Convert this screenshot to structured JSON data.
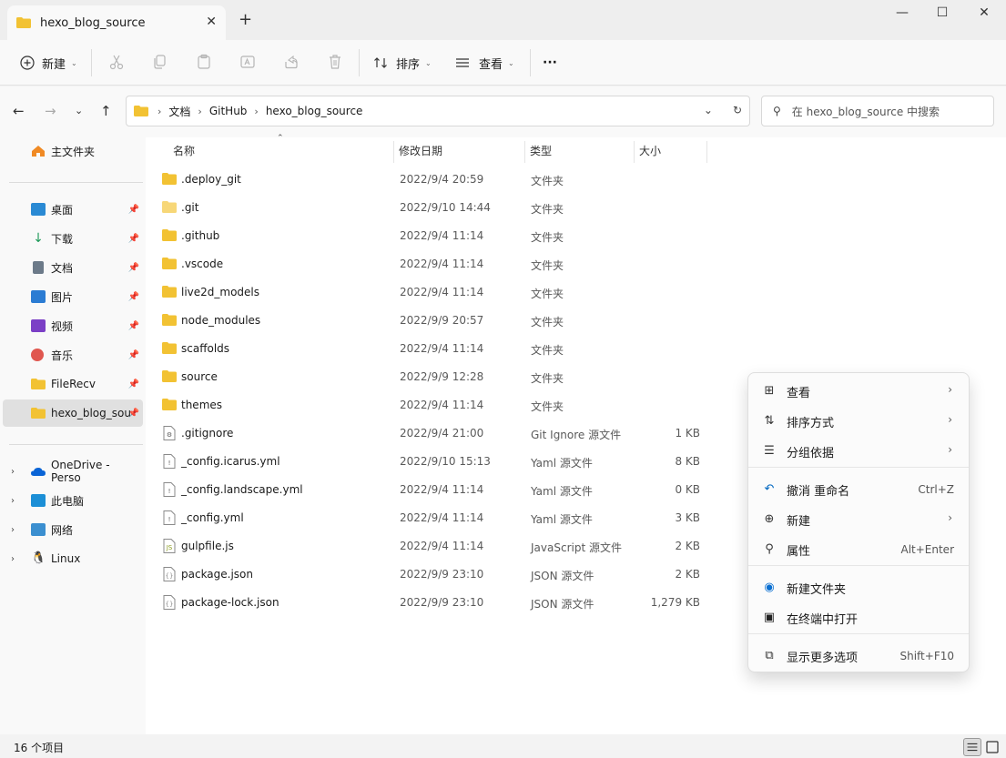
{
  "window": {
    "tab_title": "hexo_blog_source",
    "tab_close": "✕",
    "new_tab": "+",
    "minimize": "—",
    "maximize": "☐",
    "close": "✕"
  },
  "toolbar": {
    "new_label": "新建",
    "sort_label": "排序",
    "view_label": "查看",
    "more_label": "···"
  },
  "address": {
    "crumbs": [
      "文档",
      "GitHub",
      "hexo_blog_source"
    ],
    "search_placeholder": "在 hexo_blog_source 中搜索"
  },
  "sidebar": {
    "home": "主文件夹",
    "pinned": [
      {
        "label": "桌面",
        "icon": "desktop-icon",
        "color": "#2a8ad4"
      },
      {
        "label": "下载",
        "icon": "download-icon",
        "color": "#1f9a5a"
      },
      {
        "label": "文档",
        "icon": "document-icon",
        "color": "#6c7a89"
      },
      {
        "label": "图片",
        "icon": "picture-icon",
        "color": "#2b7cd3"
      },
      {
        "label": "视频",
        "icon": "video-icon",
        "color": "#7b3fc6"
      },
      {
        "label": "音乐",
        "icon": "music-icon",
        "color": "#e0574f"
      },
      {
        "label": "FileRecv",
        "icon": "folder-icon",
        "color": "#f2c233"
      },
      {
        "label": "hexo_blog_sou",
        "icon": "folder-icon",
        "color": "#f2c233"
      }
    ],
    "locations": [
      {
        "label": "OneDrive - Perso",
        "icon": "onedrive-icon"
      },
      {
        "label": "此电脑",
        "icon": "pc-icon"
      },
      {
        "label": "网络",
        "icon": "network-icon"
      },
      {
        "label": "Linux",
        "icon": "linux-icon"
      }
    ]
  },
  "columns": {
    "name": "名称",
    "modified": "修改日期",
    "type": "类型",
    "size": "大小"
  },
  "files": [
    {
      "name": ".deploy_git",
      "modified": "2022/9/4 20:59",
      "type": "文件夹",
      "size": "",
      "icon": "folder"
    },
    {
      "name": ".git",
      "modified": "2022/9/10 14:44",
      "type": "文件夹",
      "size": "",
      "icon": "folder-light"
    },
    {
      "name": ".github",
      "modified": "2022/9/4 11:14",
      "type": "文件夹",
      "size": "",
      "icon": "folder"
    },
    {
      "name": ".vscode",
      "modified": "2022/9/4 11:14",
      "type": "文件夹",
      "size": "",
      "icon": "folder"
    },
    {
      "name": "live2d_models",
      "modified": "2022/9/4 11:14",
      "type": "文件夹",
      "size": "",
      "icon": "folder"
    },
    {
      "name": "node_modules",
      "modified": "2022/9/9 20:57",
      "type": "文件夹",
      "size": "",
      "icon": "folder"
    },
    {
      "name": "scaffolds",
      "modified": "2022/9/4 11:14",
      "type": "文件夹",
      "size": "",
      "icon": "folder"
    },
    {
      "name": "source",
      "modified": "2022/9/9 12:28",
      "type": "文件夹",
      "size": "",
      "icon": "folder"
    },
    {
      "name": "themes",
      "modified": "2022/9/4 11:14",
      "type": "文件夹",
      "size": "",
      "icon": "folder"
    },
    {
      "name": ".gitignore",
      "modified": "2022/9/4 21:00",
      "type": "Git Ignore 源文件",
      "size": "1 KB",
      "icon": "file-gear"
    },
    {
      "name": "_config.icarus.yml",
      "modified": "2022/9/10 15:13",
      "type": "Yaml 源文件",
      "size": "8 KB",
      "icon": "file-bang"
    },
    {
      "name": "_config.landscape.yml",
      "modified": "2022/9/4 11:14",
      "type": "Yaml 源文件",
      "size": "0 KB",
      "icon": "file-bang"
    },
    {
      "name": "_config.yml",
      "modified": "2022/9/4 11:14",
      "type": "Yaml 源文件",
      "size": "3 KB",
      "icon": "file-bang"
    },
    {
      "name": "gulpfile.js",
      "modified": "2022/9/4 11:14",
      "type": "JavaScript 源文件",
      "size": "2 KB",
      "icon": "file-js"
    },
    {
      "name": "package.json",
      "modified": "2022/9/9 23:10",
      "type": "JSON 源文件",
      "size": "2 KB",
      "icon": "file-json"
    },
    {
      "name": "package-lock.json",
      "modified": "2022/9/9 23:10",
      "type": "JSON 源文件",
      "size": "1,279 KB",
      "icon": "file-json"
    }
  ],
  "status": {
    "count": "16 个项目"
  },
  "context_menu": [
    {
      "label": "查看",
      "icon": "grid-icon",
      "glyph": "⊞",
      "shortcut": "",
      "submenu": true
    },
    {
      "label": "排序方式",
      "icon": "sort-icon",
      "glyph": "⇅",
      "shortcut": "",
      "submenu": true
    },
    {
      "label": "分组依据",
      "icon": "group-icon",
      "glyph": "☰",
      "shortcut": "",
      "submenu": true
    },
    {
      "label": "撤消 重命名",
      "icon": "undo-icon",
      "glyph": "↶",
      "shortcut": "Ctrl+Z",
      "submenu": false
    },
    {
      "label": "新建",
      "icon": "new-icon",
      "glyph": "⊕",
      "shortcut": "",
      "submenu": true
    },
    {
      "label": "属性",
      "icon": "wrench-icon",
      "glyph": "⚲",
      "shortcut": "Alt+Enter",
      "submenu": false
    },
    {
      "label": "新建文件夹",
      "icon": "vscode-icon",
      "glyph": "◉",
      "shortcut": "",
      "submenu": false
    },
    {
      "label": "在终端中打开",
      "icon": "terminal-icon",
      "glyph": "▣",
      "shortcut": "",
      "submenu": false
    },
    {
      "label": "显示更多选项",
      "icon": "more-options-icon",
      "glyph": "⧉",
      "shortcut": "Shift+F10",
      "submenu": false
    }
  ],
  "colors": {
    "folder": "#f2c233",
    "folder_light": "#f7d778",
    "accent": "#0067c0"
  }
}
